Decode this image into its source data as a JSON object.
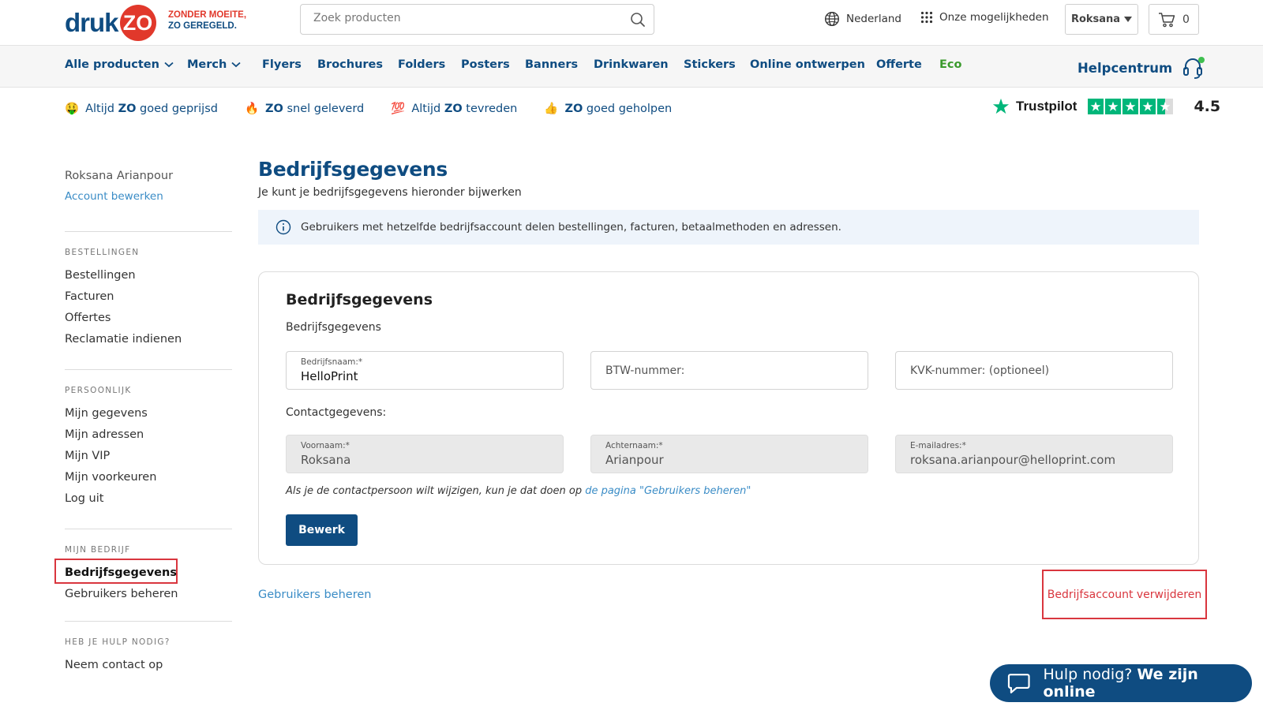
{
  "brand": {
    "logo_text": "druk",
    "logo_circle": "ZO",
    "slogan_line1": "ZONDER MOEITE,",
    "slogan_line2": "ZO GEREGELD."
  },
  "header": {
    "search_placeholder": "Zoek producten",
    "country": "Nederland",
    "options": "Onze mogelijkheden",
    "user": "Roksana",
    "cart_count": "0"
  },
  "nav": {
    "items": [
      "Alle producten",
      "Merch",
      "Flyers",
      "Brochures",
      "Folders",
      "Posters",
      "Banners",
      "Drinkwaren",
      "Stickers",
      "Online ontwerpen",
      "Offerte",
      "Eco"
    ],
    "help": "Helpcentrum"
  },
  "usps": [
    {
      "pre": "Altijd ",
      "bold": "ZO",
      "post": " goed geprijsd",
      "icon": "money-face-emoji"
    },
    {
      "pre": "",
      "bold": "ZO",
      "post": " snel geleverd",
      "icon": "fire-emoji"
    },
    {
      "pre": "Altijd ",
      "bold": "ZO",
      "post": " tevreden",
      "icon": "hundred-emoji"
    },
    {
      "pre": "",
      "bold": "ZO",
      "post": " goed geholpen",
      "icon": "thumbs-up-emoji"
    }
  ],
  "trustpilot": {
    "name": "Trustpilot",
    "score": "4.5",
    "colors": {
      "star": "#00b67a"
    }
  },
  "sidebar": {
    "user_name": "Roksana Arianpour",
    "edit_account": "Account bewerken",
    "orders": {
      "heading": "BESTELLINGEN",
      "items": [
        "Bestellingen",
        "Facturen",
        "Offertes",
        "Reclamatie indienen"
      ]
    },
    "personal": {
      "heading": "PERSOONLIJK",
      "items": [
        "Mijn gegevens",
        "Mijn adressen",
        "Mijn VIP",
        "Mijn voorkeuren",
        "Log uit"
      ]
    },
    "company": {
      "heading": "MIJN BEDRIJF",
      "items": [
        "Bedrijfsgegevens",
        "Gebruikers beheren"
      ]
    },
    "help": {
      "heading": "HEB JE HULP NODIG?",
      "items": [
        "Neem contact op"
      ]
    }
  },
  "main": {
    "title": "Bedrijfsgegevens",
    "subtitle": "Je kunt je bedrijfsgegevens hieronder bijwerken",
    "info": "Gebruikers met hetzelfde bedrijfsaccount delen bestellingen, facturen, betaalmethoden en adressen.",
    "card": {
      "title": "Bedrijfsgegevens",
      "section_company": "Bedrijfsgegevens",
      "company_name_label": "Bedrijfsnaam:*",
      "company_name_value": "HelloPrint",
      "vat_placeholder": "BTW-nummer:",
      "kvk_placeholder": "KVK-nummer: (optioneel)",
      "section_contact": "Contactgegevens:",
      "first_name_label": "Voornaam:*",
      "first_name_value": "Roksana",
      "last_name_label": "Achternaam:*",
      "last_name_value": "Arianpour",
      "email_label": "E-mailadres:*",
      "email_value": "roksana.arianpour@helloprint.com",
      "note_text": "Als je de contactpersoon wilt wijzigen, kun je dat doen op ",
      "note_link": "de pagina \"Gebruikers beheren\"",
      "edit_button": "Bewerk"
    },
    "manage_users_link": "Gebruikers beheren",
    "delete_account_link": "Bedrijfsaccount verwijderen"
  },
  "chat": {
    "text": "Hulp nodig?",
    "bold": "We zijn online"
  },
  "colors": {
    "primary": "#0f4c81",
    "accent_red": "#e1382b",
    "link": "#3a8cc6",
    "eco": "#3a9a2c",
    "danger": "#d9363e"
  }
}
